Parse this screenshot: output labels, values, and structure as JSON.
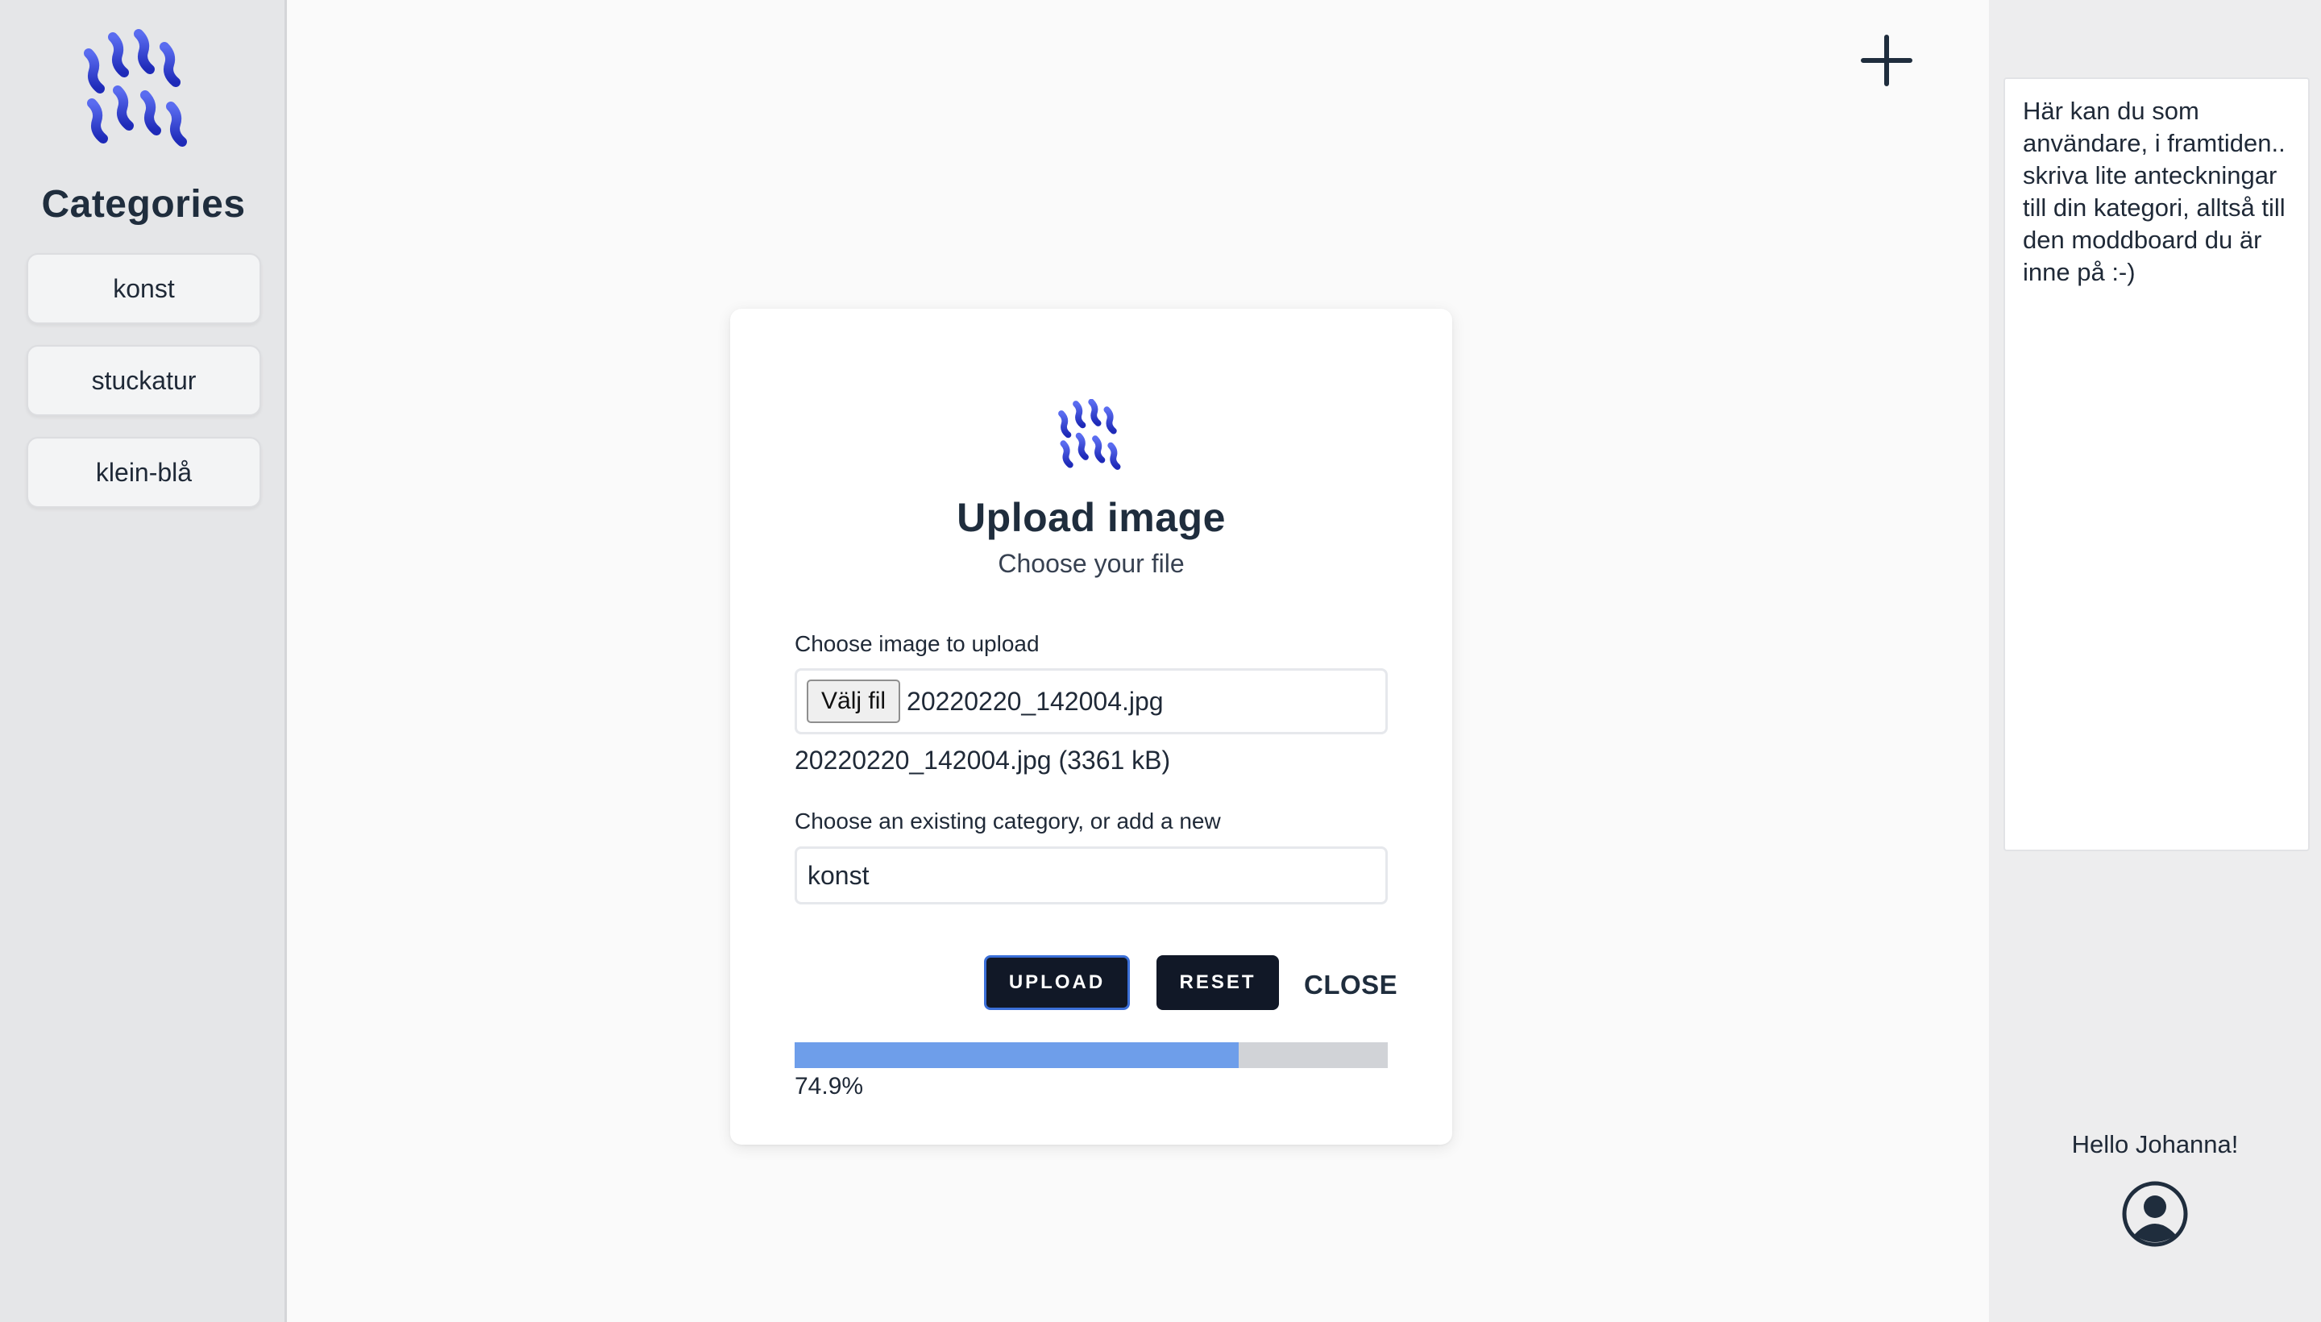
{
  "sidebar": {
    "title": "Categories",
    "items": [
      {
        "label": "konst"
      },
      {
        "label": "stuckatur"
      },
      {
        "label": "klein-blå"
      }
    ]
  },
  "header": {
    "add_icon": "plus-icon"
  },
  "modal": {
    "title": "Upload image",
    "subtitle": "Choose your file",
    "file_label": "Choose image to upload",
    "file_button": "Välj fil",
    "file_name": "20220220_142004.jpg",
    "file_info": "20220220_142004.jpg (3361 kB)",
    "category_label": "Choose an existing category, or add a new",
    "category_value": "konst",
    "upload_label": "UPLOAD",
    "reset_label": "RESET",
    "close_label": "CLOSE",
    "progress_percent": 74.9,
    "progress_text": "74.9%"
  },
  "right_panel": {
    "notes_text": "Här kan du som användare, i framtiden.. skriva lite anteckningar till din kategori, alltså till den moddboard du är inne på :-)",
    "greeting": "Hello Johanna!",
    "avatar_icon": "user-circle-icon"
  },
  "colors": {
    "brand_blue": "#2f3fd0",
    "dark_button": "#111827",
    "upload_border": "#3b6fd8",
    "progress_fill": "#6e9eea",
    "progress_track": "#d1d3d7",
    "sidebar_bg": "#e5e6e8"
  }
}
